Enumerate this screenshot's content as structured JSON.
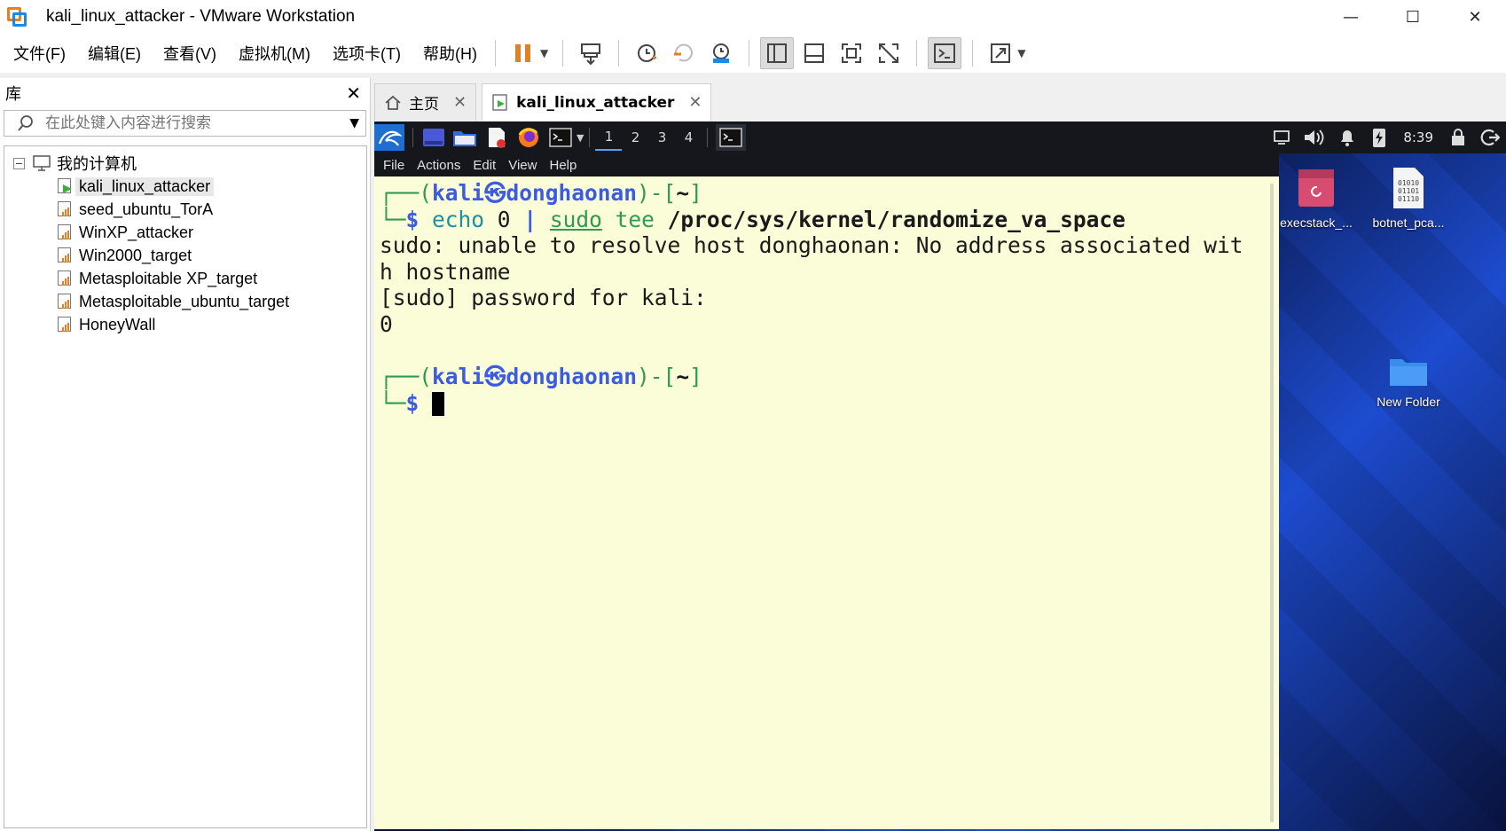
{
  "window": {
    "title": "kali_linux_attacker - VMware Workstation",
    "min": "—",
    "max": "☐",
    "close": "✕"
  },
  "menu": [
    "文件(F)",
    "编辑(E)",
    "查看(V)",
    "虚拟机(M)",
    "选项卡(T)",
    "帮助(H)"
  ],
  "library": {
    "title": "库",
    "close": "✕",
    "search_placeholder": "在此处键入内容进行搜索",
    "root_label": "我的计算机",
    "expander": "−",
    "vms": [
      {
        "name": "kali_linux_attacker",
        "running": true
      },
      {
        "name": "seed_ubuntu_TorA",
        "running": false
      },
      {
        "name": "WinXP_attacker",
        "running": false
      },
      {
        "name": "Win2000_target",
        "running": false
      },
      {
        "name": "Metasploitable XP_target",
        "running": false
      },
      {
        "name": "Metasploitable_ubuntu_target",
        "running": false
      },
      {
        "name": "HoneyWall",
        "running": false
      }
    ]
  },
  "tabs": [
    {
      "label": "主页",
      "close": "✕"
    },
    {
      "label": "kali_linux_attacker",
      "close": "✕"
    }
  ],
  "guest": {
    "workspaces": [
      "1",
      "2",
      "3",
      "4"
    ],
    "clock": "8:39",
    "term_menu": [
      "File",
      "Actions",
      "Edit",
      "View",
      "Help"
    ],
    "terminal": {
      "prompt_open": "┌──(",
      "user": "kali",
      "at": "㉿",
      "host": "donghaonan",
      "prompt_close": ")-[",
      "cwd": "~",
      "prompt_end": "]",
      "prompt2": "└─",
      "dollar": "$ ",
      "cmd_echo": "echo",
      "cmd_arg": " 0 ",
      "pipe": "|",
      "cmd_sudo": "sudo",
      "cmd_tee": " tee ",
      "cmd_path": "/proc/sys/kernel/randomize_va_space",
      "out1": "sudo: unable to resolve host donghaonan: No address associated wit",
      "out2": "h hostname",
      "out3": "[sudo] password for kali:",
      "out4": "0"
    },
    "desktop_icons": [
      "execstack_...",
      "botnet_pca...",
      "New Folder"
    ]
  }
}
